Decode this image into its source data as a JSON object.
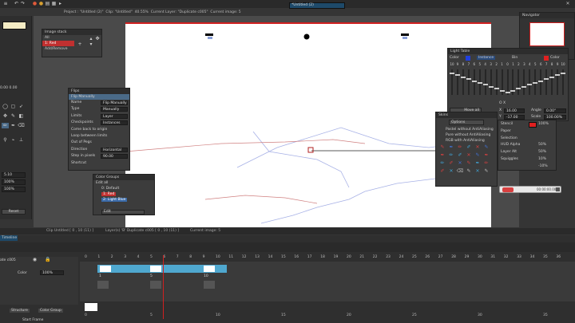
{
  "topbar": {
    "project": "Project : \"Untitled (2)\"",
    "clip": "Clip: \"Untitled\"",
    "zoom": "40.55%",
    "layer": "Current Layer: \"Duplicate c005\"",
    "image": "Current image: 5",
    "document_tab": "*Untitled (2)"
  },
  "image_stack": {
    "title": "Image stack",
    "items": [
      "All",
      "1: Red",
      "Add/Remove"
    ]
  },
  "flips": {
    "title": "Flips",
    "selected": "Flip Manually",
    "rows": [
      {
        "label": "Name",
        "value": "Flip Manually"
      },
      {
        "label": "Type",
        "value": "Manually"
      },
      {
        "label": "Limits",
        "value": "Layer"
      },
      {
        "label": "Checkpoints",
        "value": "Instances"
      },
      {
        "label": "Come back to origin",
        "value": ""
      },
      {
        "label": "Loop between limits",
        "value": ""
      },
      {
        "label": "Out of Pegs",
        "value": ""
      },
      {
        "label": "Direction",
        "value": "Horizontal"
      },
      {
        "label": "Step in pixels",
        "value": "90.00"
      },
      {
        "label": "Shortcut",
        "value": ""
      }
    ]
  },
  "color_groups": {
    "title": "Color Groups",
    "edit": "Edit all",
    "items": [
      "0: Default",
      "1: Red",
      "2: Light Blue"
    ],
    "edit_btn": "Edit"
  },
  "light_table": {
    "title": "Light Table",
    "headers": [
      "Color",
      "Instance",
      "Bin",
      "Color"
    ],
    "scale_numbers": [
      "10",
      "9",
      "8",
      "7",
      "6",
      "5",
      "4",
      "3",
      "2",
      "1",
      "0",
      "1",
      "2",
      "3",
      "4",
      "5",
      "6",
      "7",
      "8",
      "9",
      "10"
    ],
    "move_all": "Move all",
    "x_label": "X",
    "x_value": "16.00",
    "y_label": "Y",
    "y_value": "-17.00",
    "angle_label": "Angle",
    "angle_value": "0.00°",
    "scale_label": "Scale",
    "scale_value": "100.00%",
    "ox_label": "O  X"
  },
  "skins": {
    "title": "Skins",
    "options": "Options",
    "items": [
      "Pastel without AntiAliasing",
      "Pure without AntiAliasing",
      "RGB with AntiAliasing"
    ]
  },
  "stencil": {
    "rows": [
      {
        "label": "Stencil",
        "value": "100%"
      },
      {
        "label": "Paper",
        "value": ""
      },
      {
        "label": "Selection",
        "value": ""
      },
      {
        "label": "HUD Alpha",
        "value": "50%"
      },
      {
        "label": "Layer Alt",
        "value": "50%"
      },
      {
        "label": "Squiggles",
        "value": "10%"
      },
      {
        "label": "",
        "value": "-10%"
      }
    ]
  },
  "navigator": {
    "title": "Navigator"
  },
  "left_panel": {
    "values": [
      "5.10",
      "100%",
      "100%"
    ],
    "coord": "0.00 0.00",
    "reset": "Reset"
  },
  "statusbar": {
    "clip": "Clip Untitled [ 0 , 10 (11) ]",
    "layers": "Layer(s) 'B' Duplicate c005 [ 0 , 10 (11) ]",
    "image": "Current image: 5"
  },
  "timeline": {
    "title": "Timeline",
    "layer_name": "ate c005",
    "color_label": "Color",
    "opacity": "100%",
    "start_frame": "Start Frame",
    "tabs": [
      "Structure",
      "Color Group"
    ],
    "ruler": [
      "0",
      "1",
      "2",
      "3",
      "4",
      "5",
      "6",
      "7",
      "8",
      "9",
      "10",
      "11",
      "12",
      "13",
      "14",
      "15",
      "16",
      "17",
      "18",
      "19",
      "20",
      "21",
      "22",
      "23",
      "24",
      "25",
      "26",
      "27",
      "28",
      "29",
      "30",
      "31",
      "32",
      "33",
      "34",
      "35",
      "36"
    ],
    "bottom_ruler": [
      "0",
      "5",
      "10",
      "15",
      "20",
      "25",
      "30",
      "35"
    ],
    "cell_labels": [
      "1",
      "5",
      "10"
    ]
  },
  "recorder": {
    "time": "00:00:00.00"
  },
  "colors": {
    "accent": "#4fb3d9",
    "red": "#e02020",
    "lightblue": "#6a9ad0"
  }
}
